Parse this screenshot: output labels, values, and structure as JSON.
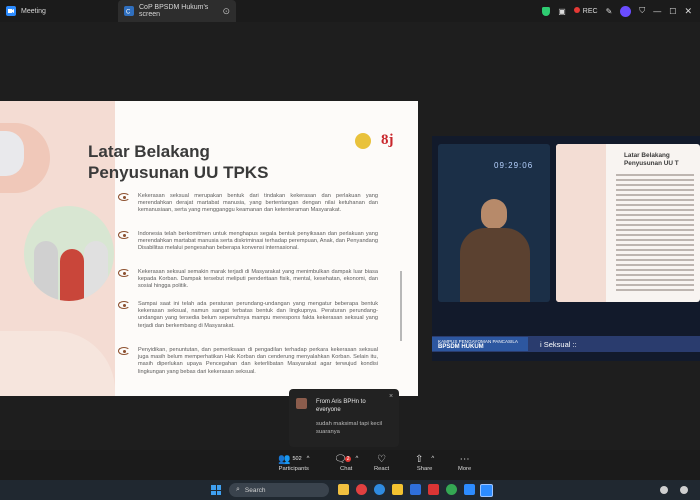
{
  "titlebar": {
    "tabs": [
      {
        "label": "Meeting"
      },
      {
        "label": "CoP BPSDM Hukum's screen"
      }
    ],
    "rec_label": "REC"
  },
  "slide": {
    "title_line1": "Latar Belakang",
    "title_line2": "Penyusunan UU TPKS",
    "logo_text": "8j",
    "paragraphs": [
      "Kekerasan seksual merupakan bentuk dari tindakan kekerasan dan perlakuan yang merendahkan derajat martabat manusia, yang bertentangan dengan nilai ketuhanan dan kemanusiaan, serta yang mengganggu keamanan dan ketenteraman Masyarakat.",
      "Indonesia telah berkomitmen untuk menghapus segala bentuk penyiksaan dan perlakuan yang merendahkan martabat manusia serta diskriminasi terhadap perempuan, Anak, dan Penyandang Disabilitas melalui pengesahan beberapa konvensi internasional.",
      "Kekerasan seksual semakin marak terjadi di Masyarakat yang menimbulkan dampak luar biasa kepada Korban. Dampak tersebut meliputi penderitaan fisik, mental, kesehatan, ekonomi, dan sosial hingga politik.",
      "Sampai saat ini telah ada peraturan perundang-undangan yang mengatur beberapa bentuk kekerasan seksual, namun sangat terbatas bentuk dan lingkupnya. Peraturan perundang-undangan yang tersedia belum sepenuhnya mampu merespons fakta kekerasan seksual yang terjadi dan berkembang di Masyarakat.",
      "Penyidikan, penuntutan, dan pemeriksaan di pengadilan terhadap perkara kekerasan seksual juga masih belum memperhatikan Hak Korban dan cenderung menyalahkan Korban. Selain itu, masih diperlukan upaya Pencegahan dan keterlibatan Masyarakat agar terwujud kondisi lingkungan yang bebas dari kekerasan seksual."
    ]
  },
  "video_panel": {
    "screen_digits": "09:29:06",
    "mini_title_line1": "Latar Belakang",
    "mini_title_line2": "Penyusunan UU T",
    "ticker_badge_line1": "KAMPUS PENGAYOMAN PANCASILA",
    "ticker_badge_line2": "BPSDM HUKUM",
    "ticker_text": "i Seksual ::"
  },
  "chat_notification": {
    "from": "From Aris BPHn to everyone",
    "message": "sudah maksimal tapi kecil suaranya",
    "close": "×"
  },
  "toolbar": {
    "participants_label": "Participants",
    "participants_count": "502",
    "chat_label": "Chat",
    "chat_badge": "2",
    "react_label": "React",
    "share_label": "Share",
    "more_label": "More"
  },
  "taskbar": {
    "search_placeholder": "Search"
  },
  "colors": {
    "accent_brown": "#8c4f2e",
    "rec_red": "#e53935",
    "shield_green": "#2ecc71"
  }
}
